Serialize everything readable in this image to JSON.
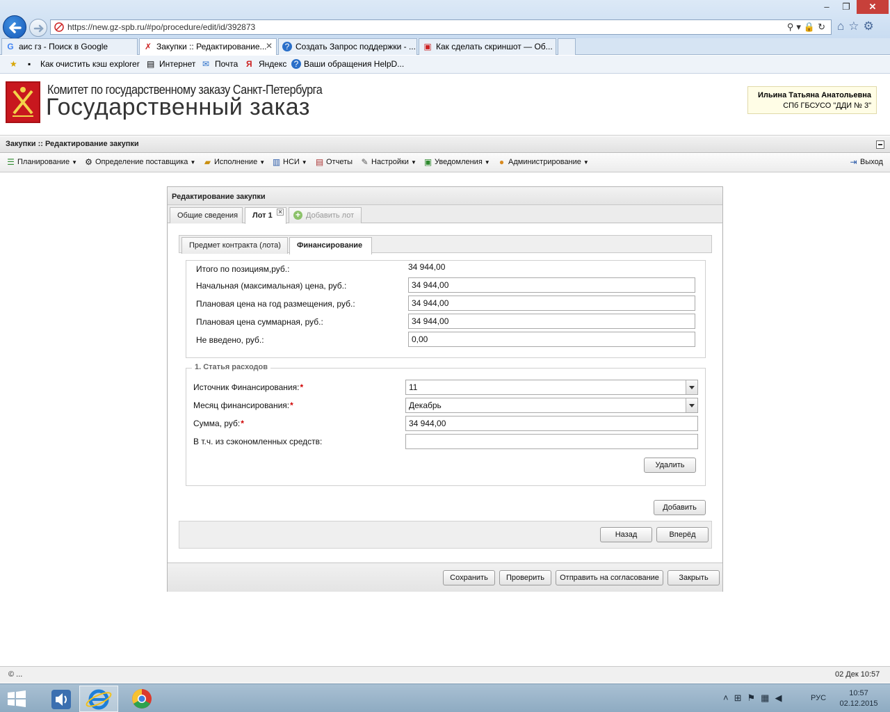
{
  "browser": {
    "url": "https://new.gz-spb.ru/#po/procedure/edit/id/392873",
    "tabs": [
      {
        "label": "аис гз - Поиск в Google",
        "icon": "google-icon"
      },
      {
        "label": "Закупки :: Редактирование...",
        "icon": "app-icon",
        "active": true
      },
      {
        "label": "Создать Запрос поддержки - ...",
        "icon": "help-icon"
      },
      {
        "label": "Как сделать скриншот — Об...",
        "icon": "page-icon"
      }
    ],
    "favorites": [
      "Как очистить кэш explorer",
      "Интернет",
      "Почта",
      "Яндекс",
      "Ваши обращения  HelpD..."
    ]
  },
  "header": {
    "org_sub": "Комитет по государственному заказу Санкт-Петербурга",
    "org_main": "Государственный заказ",
    "user_name": "Ильина Татьяна Анатольевна",
    "user_org": "СПб ГБСУСО \"ДДИ № 3\""
  },
  "page": {
    "title": "Закупки :: Редактирование закупки"
  },
  "menu": {
    "items": [
      {
        "label": "Планирование",
        "dropdown": true
      },
      {
        "label": "Определение поставщика",
        "dropdown": true
      },
      {
        "label": "Исполнение",
        "dropdown": true
      },
      {
        "label": "НСИ",
        "dropdown": true
      },
      {
        "label": "Отчеты",
        "dropdown": false
      },
      {
        "label": "Настройки",
        "dropdown": true
      },
      {
        "label": "Уведомления",
        "dropdown": true
      },
      {
        "label": "Администрирование",
        "dropdown": true
      }
    ],
    "exit": "Выход"
  },
  "panel": {
    "title": "Редактирование закупки",
    "tabs": [
      "Общие сведения",
      "Лот 1",
      "Добавить лот"
    ],
    "subtabs": [
      "Предмет контракта (лота)",
      "Финансирование"
    ],
    "totals": {
      "total_label": "Итого по позициям,руб.:",
      "total_value": "34 944,00",
      "max_price_label": "Начальная (максимальная) цена, руб.:",
      "max_price_value": "34 944,00",
      "plan_year_label": "Плановая цена на год размещения, руб.:",
      "plan_year_value": "34 944,00",
      "plan_sum_label": "Плановая цена суммарная, руб.:",
      "plan_sum_value": "34 944,00",
      "not_entered_label": "Не введено, руб.:",
      "not_entered_value": "0,00"
    },
    "expense": {
      "legend": "1. Статья расходов",
      "source_label": "Источник Финансирования:",
      "source_value": "11",
      "month_label": "Месяц финансирования:",
      "month_value": "Декабрь",
      "sum_label": "Сумма, руб:",
      "sum_value": "34 944,00",
      "saved_label": "В т.ч. из сэкономленных средств:",
      "saved_value": "",
      "required_mark": "*",
      "delete_button": "Удалить"
    },
    "add_button": "Добавить",
    "back_button": "Назад",
    "forward_button": "Вперёд",
    "footer_buttons": [
      "Сохранить",
      "Проверить",
      "Отправить на согласование",
      "Закрыть"
    ]
  },
  "status": {
    "left": "© ...",
    "right": "02 Дек 10:57"
  },
  "taskbar": {
    "lang": "РУС",
    "time": "10:57",
    "date": "02.12.2015"
  }
}
